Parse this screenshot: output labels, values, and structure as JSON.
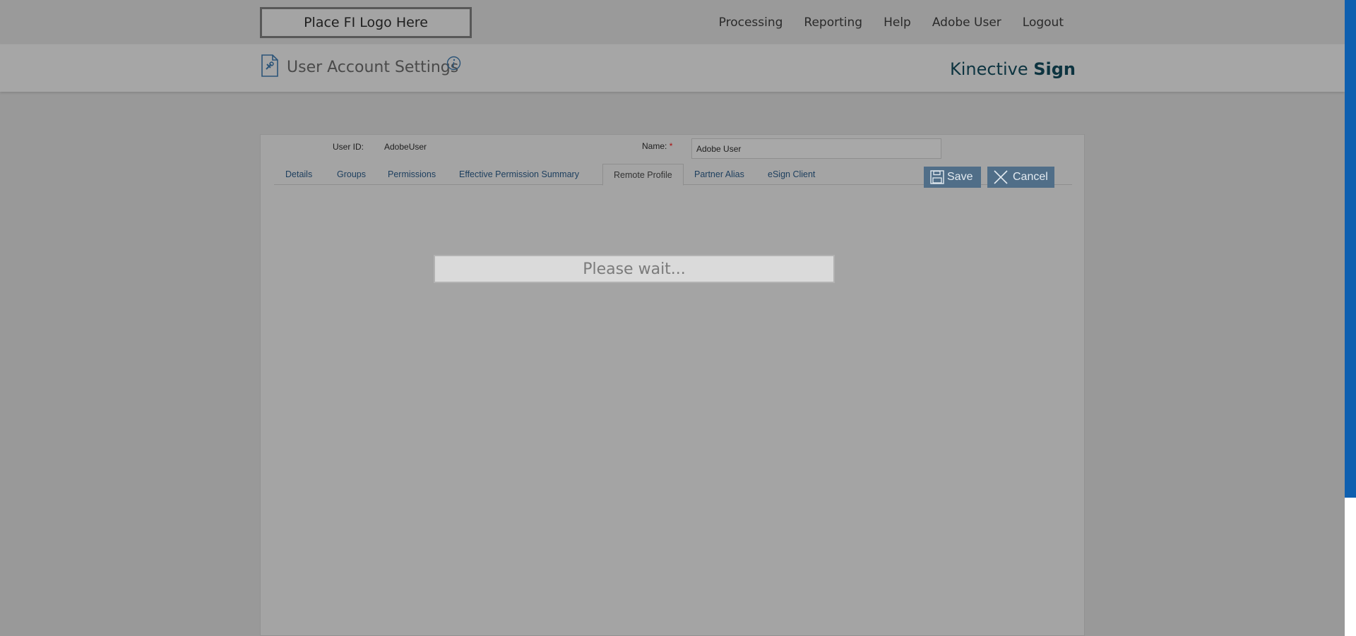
{
  "header": {
    "logo_text": "Place FI Logo Here",
    "nav": [
      "Processing",
      "Reporting",
      "Help",
      "Adobe User",
      "Logout"
    ]
  },
  "titlebar": {
    "title": "User Account Settings",
    "brand_regular": "Kinective ",
    "brand_bold": "Sign"
  },
  "form": {
    "userid_label": "User ID:",
    "userid_value": "AdobeUser",
    "name_label": "Name:",
    "required_marker": "*",
    "name_value": "Adobe User"
  },
  "tabs": [
    "Details",
    "Groups",
    "Permissions",
    "Effective Permission Summary",
    "Remote Profile",
    "Partner Alias",
    "eSign Client"
  ],
  "active_tab": "Remote Profile",
  "buttons": {
    "save": "Save",
    "cancel": "Cancel"
  },
  "overlay": {
    "wait_text": "Please wait..."
  },
  "colors": {
    "accent": "#0e5faf",
    "button": "#506e88",
    "link": "#1c3e5e",
    "brand": "#0d3440"
  },
  "icons": {
    "page": "settings-document-icon",
    "info": "info-icon",
    "save": "floppy-disk-icon",
    "cancel": "close-icon"
  }
}
